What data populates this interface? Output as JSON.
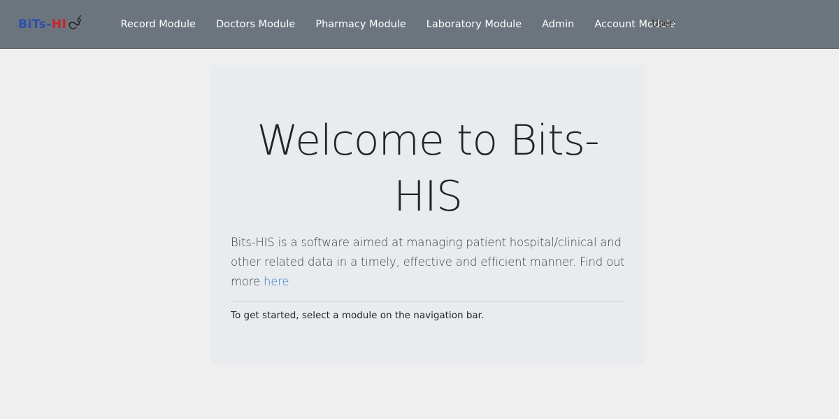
{
  "app": {
    "brand": {
      "part1": "BiTs",
      "dash": "-",
      "part2": "HI"
    }
  },
  "navbar": {
    "items": [
      {
        "label": "Record Module"
      },
      {
        "label": "Doctors Module"
      },
      {
        "label": "Pharmacy Module"
      },
      {
        "label": "Laboratory Module"
      },
      {
        "label": "Admin"
      },
      {
        "label": "Account Module"
      }
    ],
    "user_label": "User:"
  },
  "main": {
    "title": "Welcome to Bits-HIS",
    "lead_text": "Bits-HIS is a software aimed at managing patient hospital/clinical and other related data in a timely, effective and efficient manner. Find out more ",
    "lead_link": "here",
    "note": "To get started, select a module on the navigation bar."
  },
  "colors": {
    "navbar_bg": "#6c757d",
    "page_bg": "#efefef",
    "panel_bg": "#e9ecef",
    "link": "#3d7cc9",
    "brand_blue": "#2a4fb0",
    "brand_red": "#d11f2a"
  },
  "icons": {
    "brand": "stethoscope-icon"
  }
}
